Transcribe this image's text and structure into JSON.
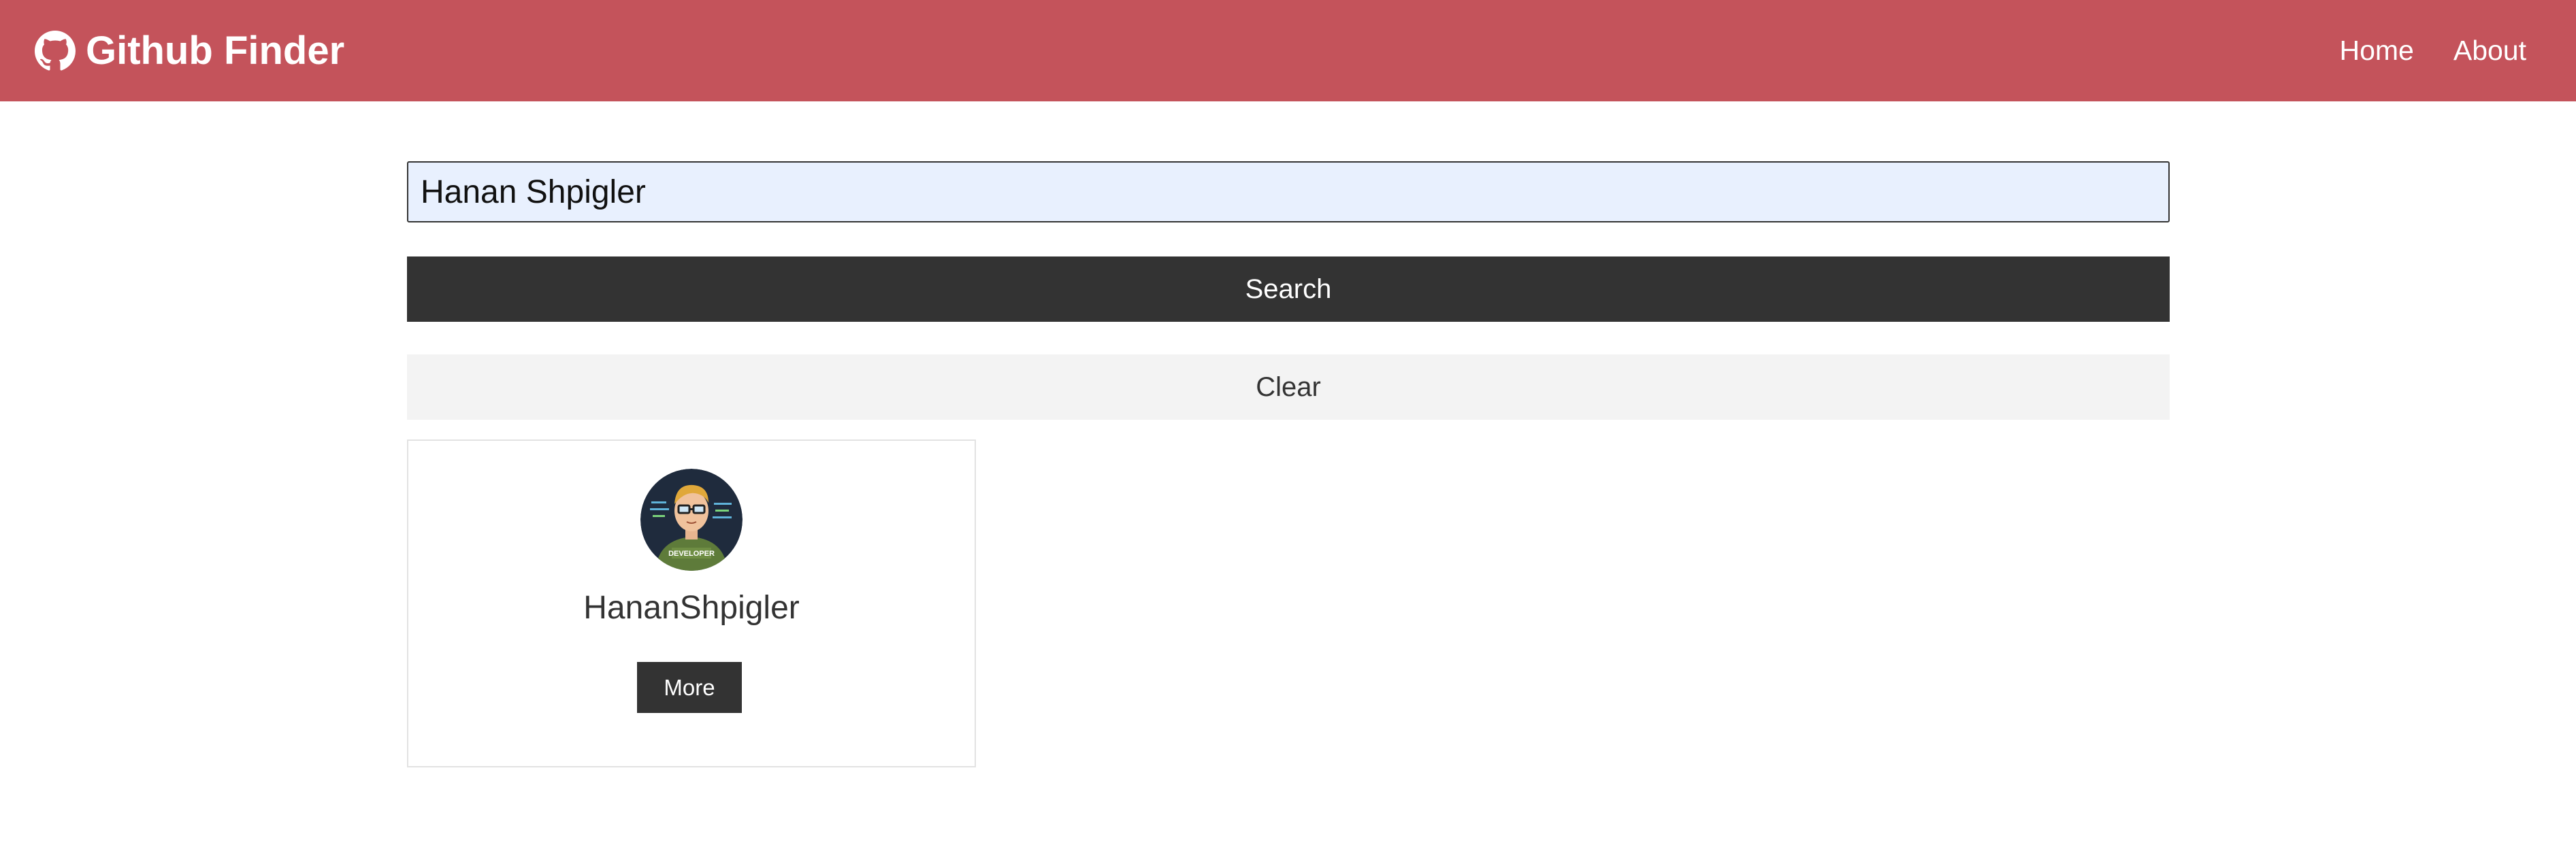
{
  "navbar": {
    "title": "Github Finder",
    "icon": "github-icon",
    "background_color": "#c4535b",
    "links": [
      {
        "label": "Home"
      },
      {
        "label": "About"
      }
    ]
  },
  "search": {
    "value": "Hanan Shpigler",
    "placeholder": "",
    "search_label": "Search",
    "clear_label": "Clear"
  },
  "results": [
    {
      "username": "HananShpigler",
      "avatar_icon": "developer-avatar",
      "avatar_text": "DEVELOPER",
      "more_label": "More"
    }
  ]
}
